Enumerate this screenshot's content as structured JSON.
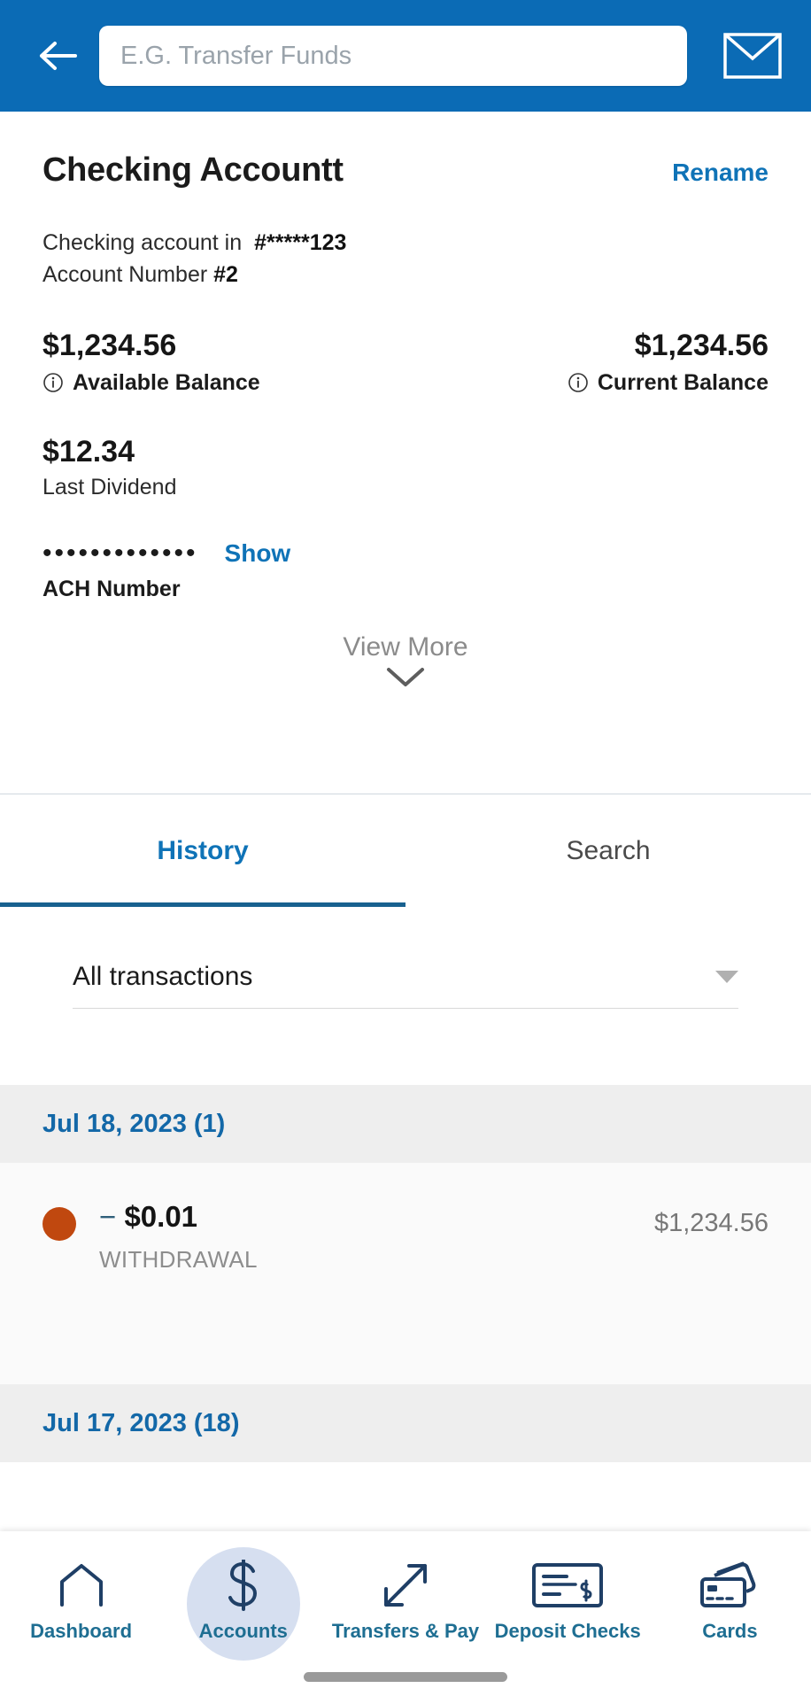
{
  "header": {
    "back_icon": "arrow-left-icon",
    "search_placeholder": "E.G. Transfer Funds",
    "search_value": "",
    "mail_icon": "envelope-icon",
    "bar_color": "#0b6bb5"
  },
  "account": {
    "title": "Checking Accountt",
    "rename_label": "Rename",
    "type_label": "Checking account in",
    "masked_number": "#*****123",
    "account_number_label": "Account Number",
    "account_number_value": "#2",
    "available": {
      "amount": "$1,234.56",
      "label": "Available Balance",
      "icon": "info-circle-icon"
    },
    "current": {
      "amount": "$1,234.56",
      "label": "Current Balance",
      "icon": "info-circle-icon"
    },
    "dividend": {
      "amount": "$12.34",
      "label": "Last Dividend"
    },
    "ach": {
      "masked": "•••••••••••••",
      "show_label": "Show",
      "label": "ACH Number"
    },
    "view_more_label": "View More",
    "view_more_icon": "chevron-down-icon",
    "link_color": "#0f73b7"
  },
  "tabs": [
    {
      "label": "History",
      "active": true
    },
    {
      "label": "Search",
      "active": false
    }
  ],
  "filter": {
    "value": "All transactions",
    "icon": "caret-down-icon"
  },
  "transactions": {
    "groups": [
      {
        "date_header": "Jul 18, 2023 (1)",
        "items": [
          {
            "dot_color": "#c0480f",
            "sign": "−",
            "amount": "$0.01",
            "type": "WITHDRAWAL",
            "running_balance": "$1,234.56"
          }
        ]
      },
      {
        "date_header": "Jul 17, 2023 (18)",
        "items": []
      }
    ]
  },
  "bottom_nav": {
    "items": [
      {
        "label": "Dashboard",
        "icon": "home-icon",
        "active": false
      },
      {
        "label": "Accounts",
        "icon": "dollar-sign-icon",
        "active": true
      },
      {
        "label": "Transfers & Pay",
        "icon": "diagonal-arrows-icon",
        "active": false
      },
      {
        "label": "Deposit Checks",
        "icon": "check-document-icon",
        "active": false
      },
      {
        "label": "Cards",
        "icon": "credit-cards-icon",
        "active": false
      }
    ],
    "accent_color": "#1e6e92",
    "active_bubble_color": "#d6dff0"
  }
}
